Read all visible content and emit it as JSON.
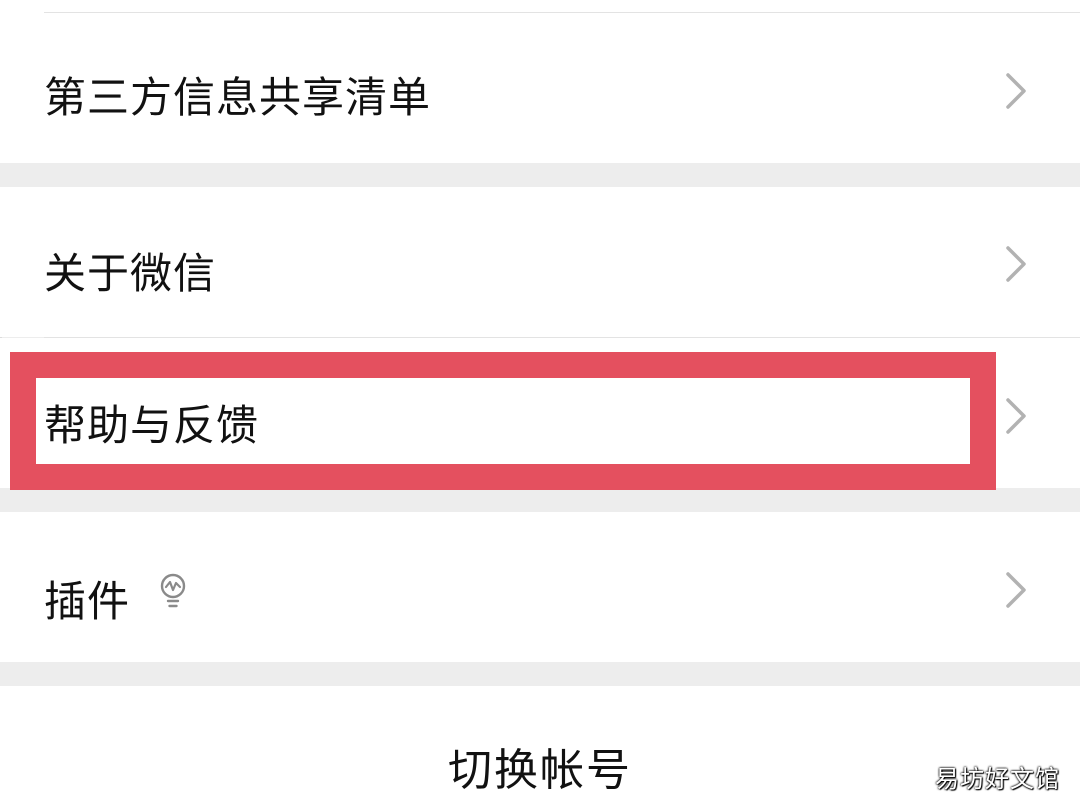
{
  "settings": {
    "items": [
      {
        "label": "第三方信息共享清单"
      },
      {
        "label": "关于微信"
      },
      {
        "label": "帮助与反馈"
      },
      {
        "label": "插件"
      }
    ],
    "switch_account": "切换帐号"
  },
  "highlight": {
    "color": "#e4505f",
    "target": "帮助与反馈"
  },
  "watermark": "易坊好文馆",
  "icons": {
    "chevron": "chevron-right-icon",
    "plugin": "lightbulb-icon"
  }
}
